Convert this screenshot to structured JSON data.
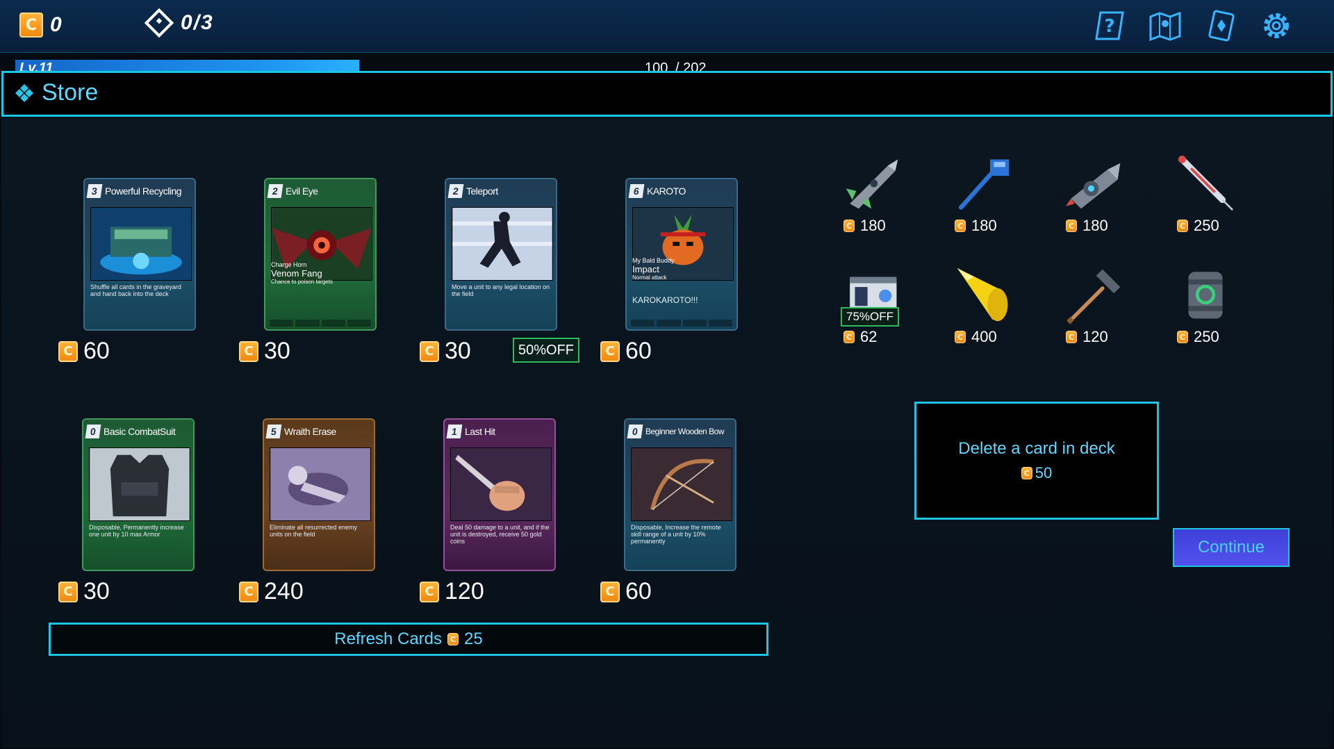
{
  "topbar": {
    "coins": "0",
    "progress": "0/3",
    "icons": [
      "help-icon",
      "map-icon",
      "deck-icon",
      "settings-icon"
    ]
  },
  "xp": {
    "level": "Lv.11",
    "current": "100",
    "max": "/ 202",
    "fraction": 0.495
  },
  "store": {
    "title": "Store"
  },
  "cards": [
    {
      "cost": "3",
      "name": "Powerful Recycling",
      "desc": "Shuffle all cards in the graveyard and hand back into the deck",
      "price": "60",
      "theme": "blue"
    },
    {
      "cost": "2",
      "name": "Evil Eye",
      "sub1": "Charge Horn",
      "sub2": "Venom Fang",
      "sub3": "Chance to poison targets",
      "price": "30",
      "theme": "green"
    },
    {
      "cost": "2",
      "name": "Teleport",
      "desc": "Move a unit to any legal location on the field",
      "price": "30",
      "theme": "blue",
      "badge": "50%OFF"
    },
    {
      "cost": "6",
      "name": "KAROTO",
      "sub1": "My Bald Buddy",
      "sub2": "Impact",
      "sub3": "Normal attack",
      "desc": "KAROKAROTO!!!",
      "price": "60",
      "theme": "blue"
    },
    {
      "cost": "0",
      "name": "Basic CombatSuit",
      "desc": "Disposable, Permanently increase one unit by 10 max Armor",
      "price": "30",
      "theme": "green"
    },
    {
      "cost": "5",
      "name": "Wraith Erase",
      "desc": "Eliminate all resurrected enemy units on the field",
      "price": "240",
      "theme": "brown"
    },
    {
      "cost": "1",
      "name": "Last Hit",
      "desc": "Deal 50 damage to a unit, and if the unit is destroyed, receive 50 gold coins",
      "price": "120",
      "theme": "purple"
    },
    {
      "cost": "0",
      "name": "Beginner Wooden Bow",
      "desc": "Disposable, Increase the remote skill range of a unit by 10% permanently",
      "price": "60",
      "theme": "blue"
    }
  ],
  "refresh": {
    "label": "Refresh Cards",
    "price": "25"
  },
  "items": [
    {
      "name": "rocket-drone-icon",
      "price": "180"
    },
    {
      "name": "wrench-staff-icon",
      "price": "180"
    },
    {
      "name": "drill-machine-icon",
      "price": "180"
    },
    {
      "name": "syringe-icon",
      "price": "250"
    },
    {
      "name": "id-card-icon",
      "price": "62",
      "badge": "75%OFF"
    },
    {
      "name": "golden-horn-icon",
      "price": "400"
    },
    {
      "name": "hammer-icon",
      "price": "120"
    },
    {
      "name": "canister-icon",
      "price": "250"
    }
  ],
  "delete": {
    "label": "Delete a card in deck",
    "price": "50"
  },
  "continue": {
    "label": "Continue"
  },
  "coin_symbol": "C",
  "colors": {
    "accent": "#1ec3e3",
    "coin": "#f5a21c",
    "discount": "#2bbd5b"
  }
}
